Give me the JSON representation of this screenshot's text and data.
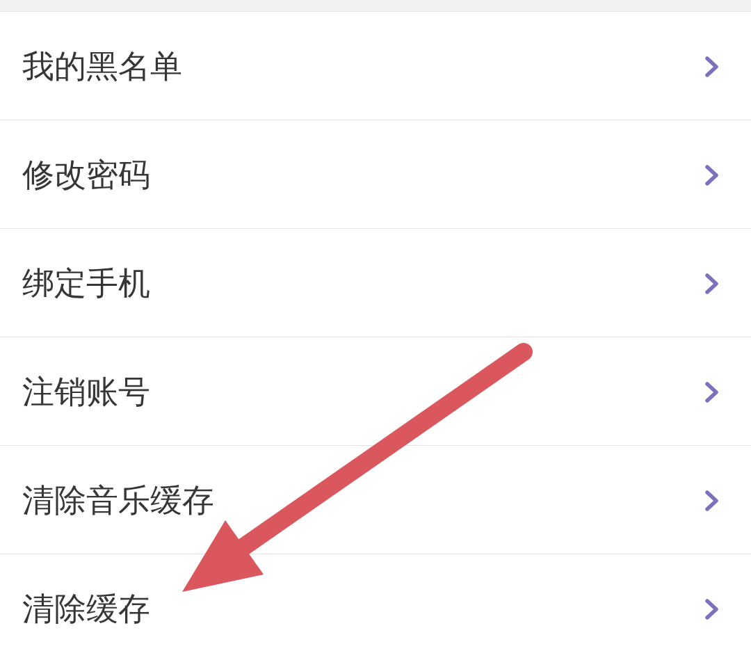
{
  "settings_items": [
    {
      "label": "我的黑名单"
    },
    {
      "label": "修改密码"
    },
    {
      "label": "绑定手机"
    },
    {
      "label": "注销账号"
    },
    {
      "label": "清除音乐缓存"
    },
    {
      "label": "清除缓存"
    }
  ]
}
